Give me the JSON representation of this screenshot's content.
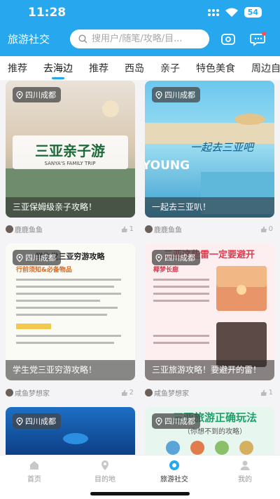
{
  "status": {
    "time": "11:28",
    "battery": "54"
  },
  "header": {
    "title": "旅游社交",
    "search_placeholder": "搜用户/随笔/攻略/目..."
  },
  "tabs": [
    "推荐",
    "去海边",
    "推荐",
    "西岛",
    "亲子",
    "特色美食",
    "周边自驾"
  ],
  "cards": [
    {
      "location": "四川成都",
      "title": "三亚保姆级亲子攻略！",
      "author": "鹿鹿鱼鱼",
      "likes": "1",
      "image_text": "三亚亲子游",
      "image_subtext": "SANYA'S FAMILY TRIP"
    },
    {
      "location": "四川成都",
      "title": "一起去三亚叭！",
      "author": "鹿鹿鱼鱼",
      "likes": "0",
      "image_text": "一起去三亚吧",
      "image_subtext": "YOUNG"
    },
    {
      "location": "四川成都",
      "title": "学生党三亚穷游攻略！",
      "author": "咸鱼梦想家",
      "likes": "2",
      "image_text": "学生党三亚穷游攻略",
      "image_subtext": "行前须知&必备物品"
    },
    {
      "location": "四川成都",
      "title": "三亚旅游攻略！要避开的雷！",
      "author": "咸鱼梦想家",
      "likes": "1",
      "image_text": "三亚这些雷一定要避开",
      "image_subtext": "椰梦长廊"
    },
    {
      "location": "四川成都"
    },
    {
      "location": "四川成都",
      "image_text": "三亚旅游正确玩法",
      "image_subtext": "（你想不到的攻略）"
    }
  ],
  "bottom_nav": [
    "首页",
    "目的地",
    "旅游社交",
    "我的"
  ]
}
